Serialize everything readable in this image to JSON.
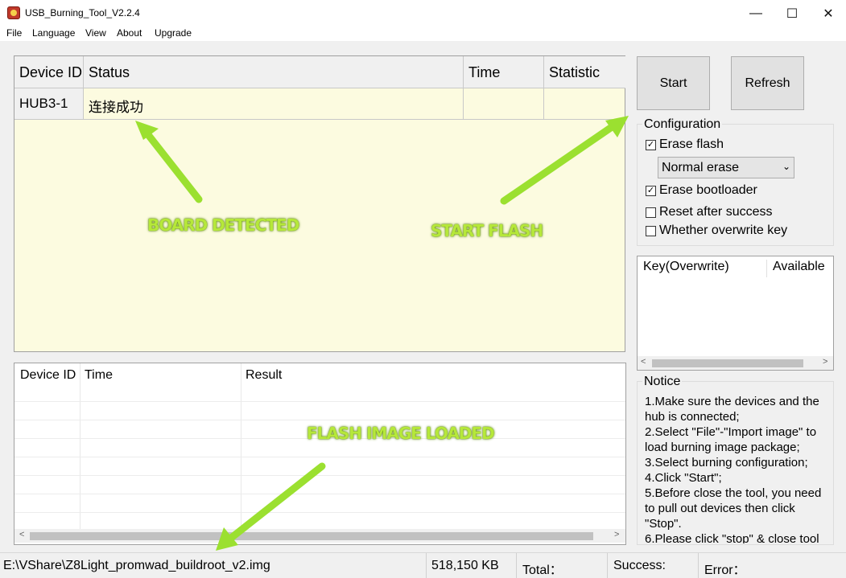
{
  "window": {
    "title": "USB_Burning_Tool_V2.2.4",
    "controls": {
      "minimize": "—",
      "maximize": "☐",
      "close": "✕"
    }
  },
  "menu": [
    "File",
    "Language",
    "View",
    "About",
    "Upgrade"
  ],
  "device_grid": {
    "columns": [
      "Device ID",
      "Status",
      "Time",
      "Statistic"
    ],
    "rows": [
      {
        "device_id": "HUB3-1",
        "status": "连接成功",
        "time": "",
        "statistic": ""
      }
    ]
  },
  "buttons": {
    "start": "Start",
    "refresh": "Refresh"
  },
  "configuration": {
    "title": "Configuration",
    "erase_flash": {
      "label": "Erase flash",
      "checked": true
    },
    "erase_mode": {
      "selected": "Normal erase"
    },
    "erase_bootloader": {
      "label": "Erase bootloader",
      "checked": true
    },
    "reset_after_success": {
      "label": "Reset after success",
      "checked": false
    },
    "overwrite_key": {
      "label": "Whether overwrite key",
      "checked": false
    }
  },
  "key_list": {
    "columns": [
      "Key(Overwrite)",
      "Available"
    ]
  },
  "notice": {
    "title": "Notice",
    "lines": [
      "1.Make sure the devices and the hub is connected;",
      "2.Select \"File\"-\"Import image\" to load burning image package;",
      "3.Select burning configuration;",
      "4.Click \"Start\";",
      "5.Before close the tool, you need to pull out devices then click \"Stop\".",
      "6.Please click \"stop\" & close tool"
    ]
  },
  "result_grid": {
    "columns": [
      "Device ID",
      "Time",
      "Result"
    ]
  },
  "status_bar": {
    "image_path": "E:\\VShare\\Z8Light_promwad_buildroot_v2.img",
    "image_size": "518,150 KB",
    "total": "Total：",
    "success": "Success:",
    "error": "Error："
  },
  "annotations": {
    "board_detected": "BOARD DETECTED",
    "start_flash": "START FLASH",
    "flash_image_loaded": "FLASH IMAGE LOADED",
    "color": "#9be030"
  }
}
